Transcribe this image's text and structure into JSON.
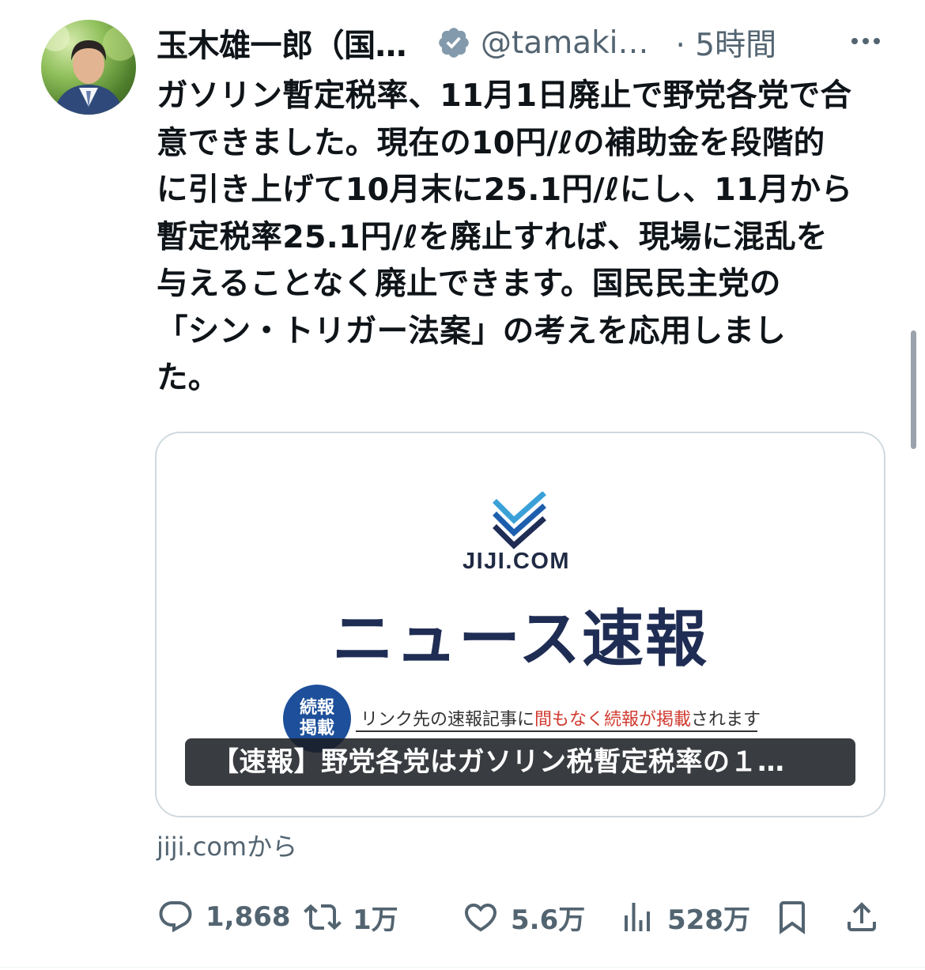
{
  "tweet": {
    "author_name": "玉木雄一郎（国…",
    "handle": "@tamaki…",
    "time": "· 5時間",
    "text_lines": [
      "ガソリン暫定税率、11月1日廃止で野党各党で合",
      "意できました。現在の10円/ℓの補助金を段階的",
      "に引き上げて10月末に25.1円/ℓにし、11月から",
      "暫定税率25.1円/ℓを廃止すれば、現場に混乱を",
      "与えることなく廃止できます。国民民主党の",
      "「シン・トリガー法案」の考えを応用しまし",
      "た。"
    ]
  },
  "card": {
    "logo_wordmark": "JIJI.COM",
    "image_title": "ニュース速報",
    "badge_line1": "続報",
    "badge_line2": "掲載",
    "notice_prefix": "リンク先の速報記事に",
    "notice_highlight": "間もなく続報が掲載",
    "notice_suffix": "されます",
    "caption": "【速報】野党各党はガソリン税暫定税率の１…",
    "source": "jiji.comから"
  },
  "actions": {
    "replies": "1,868",
    "retweets": "1万",
    "likes": "5.6万",
    "views": "528万"
  },
  "colors": {
    "secondary_text": "#536471",
    "verified_badge": "#829aab",
    "jiji_navy": "#1f2d54",
    "jiji_blue": "#1d4f9a",
    "notice_red": "#d03a2f"
  },
  "icons": [
    "verified-badge-icon",
    "more-icon",
    "reply-icon",
    "retweet-icon",
    "like-icon",
    "views-icon",
    "bookmark-icon",
    "share-icon"
  ]
}
